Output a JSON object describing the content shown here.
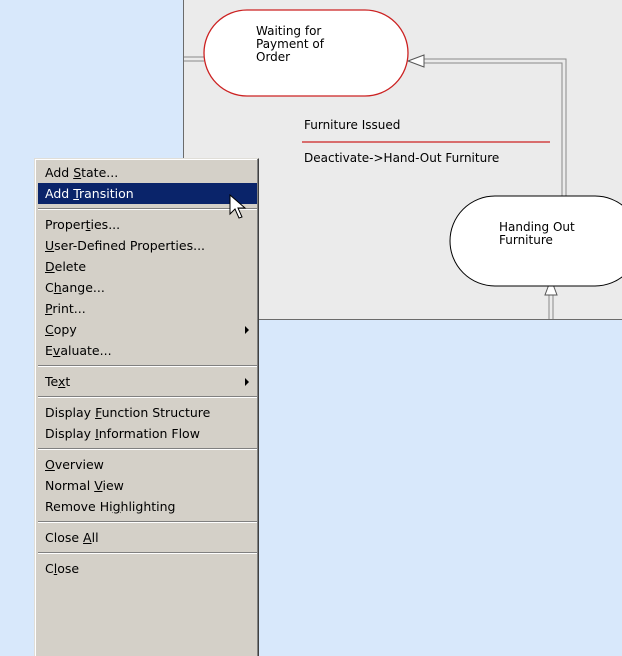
{
  "diagram": {
    "nodes": [
      {
        "id": "waiting",
        "lines": [
          "Waiting for",
          "Payment of",
          "Order"
        ],
        "border_color": "#cc2222"
      },
      {
        "id": "handing",
        "lines": [
          "Handing Out",
          "Furniture"
        ],
        "border_color": "#000000"
      }
    ],
    "transition": {
      "event": "Furniture Issued",
      "action": "Deactivate->Hand-Out Furniture",
      "divider_color": "#cc2222"
    }
  },
  "context_menu": {
    "highlight_color": "#0a246a",
    "groups": [
      [
        {
          "label": "Add State...",
          "underline": "S",
          "submenu": false,
          "highlighted": false
        },
        {
          "label": "Add Transition",
          "underline": "T",
          "submenu": false,
          "highlighted": true
        }
      ],
      [
        {
          "label": "Properties...",
          "underline": "t",
          "submenu": false,
          "highlighted": false
        },
        {
          "label": "User-Defined Properties...",
          "underline": "U",
          "submenu": false,
          "highlighted": false
        },
        {
          "label": "Delete",
          "underline": "D",
          "submenu": false,
          "highlighted": false
        },
        {
          "label": "Change...",
          "underline": "h",
          "submenu": false,
          "highlighted": false
        },
        {
          "label": "Print...",
          "underline": "P",
          "submenu": false,
          "highlighted": false
        },
        {
          "label": "Copy",
          "underline": "C",
          "submenu": true,
          "highlighted": false
        },
        {
          "label": "Evaluate...",
          "underline": "v",
          "submenu": false,
          "highlighted": false
        }
      ],
      [
        {
          "label": "Text",
          "underline": "x",
          "submenu": true,
          "highlighted": false
        }
      ],
      [
        {
          "label": "Display Function Structure",
          "underline": "F",
          "submenu": false,
          "highlighted": false
        },
        {
          "label": "Display Information Flow",
          "underline": "I",
          "submenu": false,
          "highlighted": false
        }
      ],
      [
        {
          "label": "Overview",
          "underline": "O",
          "submenu": false,
          "highlighted": false
        },
        {
          "label": "Normal View",
          "underline": "V",
          "submenu": false,
          "highlighted": false
        },
        {
          "label": "Remove Highlighting",
          "underline": "g",
          "submenu": false,
          "highlighted": false
        }
      ],
      [
        {
          "label": "Close All",
          "underline": "A",
          "submenu": false,
          "highlighted": false
        }
      ],
      [
        {
          "label": "Close",
          "underline": "l",
          "submenu": false,
          "highlighted": false
        }
      ]
    ]
  }
}
